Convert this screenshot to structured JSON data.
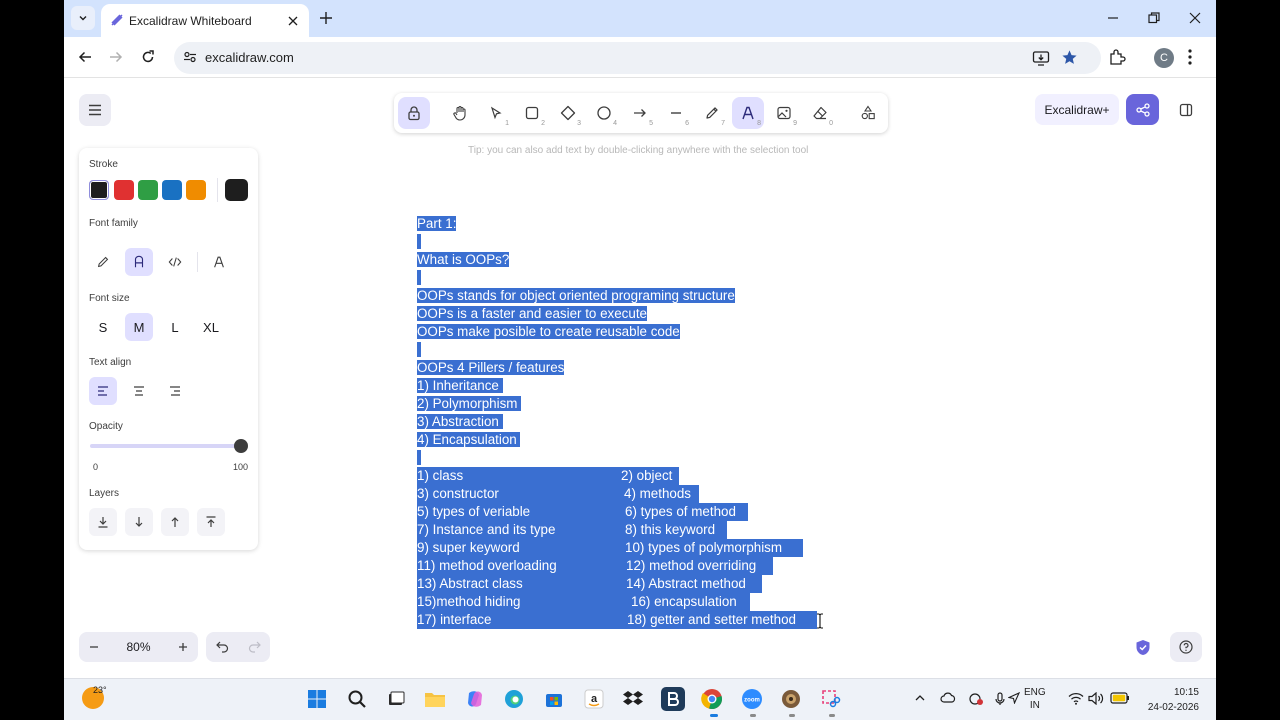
{
  "browser": {
    "tab_title": "Excalidraw Whiteboard",
    "url": "excalidraw.com",
    "profile_initial": "C"
  },
  "toolbar": {
    "tools": [
      {
        "name": "lock",
        "key": ""
      },
      {
        "name": "hand",
        "key": ""
      },
      {
        "name": "selection",
        "key": "1"
      },
      {
        "name": "rectangle",
        "key": "2"
      },
      {
        "name": "diamond",
        "key": "3"
      },
      {
        "name": "ellipse",
        "key": "4"
      },
      {
        "name": "arrow",
        "key": "5"
      },
      {
        "name": "line",
        "key": "6"
      },
      {
        "name": "draw",
        "key": "7"
      },
      {
        "name": "text",
        "key": "8"
      },
      {
        "name": "image",
        "key": "9"
      },
      {
        "name": "eraser",
        "key": "0"
      },
      {
        "name": "more-tools",
        "key": ""
      }
    ],
    "active_tool": "text",
    "tip": "Tip: you can also add text by double-clicking anywhere with the selection tool"
  },
  "header_right": {
    "plus_label": "Excalidraw+"
  },
  "properties": {
    "stroke_label": "Stroke",
    "stroke_colors": [
      "#1e1e1e",
      "#e03131",
      "#2f9e44",
      "#1971c2",
      "#f08c00"
    ],
    "current_stroke": "#1e1e1e",
    "font_family_label": "Font family",
    "font_size_label": "Font size",
    "font_sizes": [
      "S",
      "M",
      "L",
      "XL"
    ],
    "selected_font_size": "M",
    "text_align_label": "Text align",
    "opacity_label": "Opacity",
    "opacity_min": "0",
    "opacity_max": "100",
    "opacity_value": 100,
    "layers_label": "Layers"
  },
  "document": {
    "lines": [
      {
        "a": "Part 1:"
      },
      {
        "a": " "
      },
      {
        "a": "What is OOPs?"
      },
      {
        "a": " "
      },
      {
        "a": "OOPs stands for object oriented programing structure"
      },
      {
        "a": "OOPs is a faster and easier to execute"
      },
      {
        "a": "OOPs make posible to create reusable code"
      },
      {
        "a": " "
      },
      {
        "a": "OOPs 4 Pillers / features"
      },
      {
        "a": "1) Inheritance "
      },
      {
        "a": "2) Polymorphism "
      },
      {
        "a": "3) Abstraction "
      },
      {
        "a": "4) Encapsulation "
      },
      {
        "a": " "
      },
      {
        "a": "1) class",
        "b": "2) object"
      },
      {
        "a": "3) constructor",
        "b": "4) methods"
      },
      {
        "a": "5) types of veriable",
        "b": "6) types of method"
      },
      {
        "a": "7) Instance and its type",
        "b": "8) this keyword"
      },
      {
        "a": "9) super keyword",
        "b": "10) types of polymorphism"
      },
      {
        "a": "11) method overloading",
        "b": "12) method overriding"
      },
      {
        "a": "13) Abstract class",
        "b": "14) Abstract method"
      },
      {
        "a": "15)method hiding",
        "b": "16) encapsulation"
      },
      {
        "a": "17) interface",
        "b": "18) getter and setter method"
      }
    ]
  },
  "bottom": {
    "zoom": "80%"
  },
  "taskbar": {
    "temperature": "23°",
    "apps": [
      "windows-start",
      "search",
      "task-view",
      "file-explorer",
      "copilot",
      "edge",
      "microsoft-store",
      "amazon",
      "dropbox",
      "b-app",
      "chrome",
      "zoom",
      "game-app",
      "snipping-tool"
    ],
    "lang_line1": "ENG",
    "lang_line2": "IN",
    "time": "10:15",
    "date": "24-02-2026"
  }
}
